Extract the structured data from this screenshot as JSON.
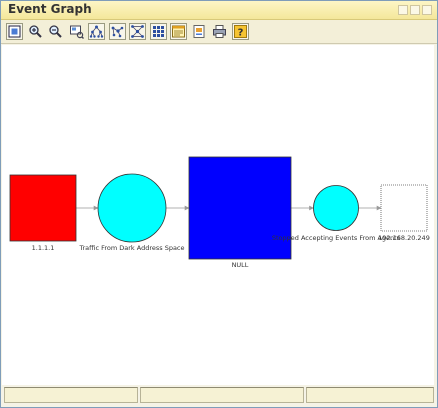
{
  "window": {
    "title": "Event Graph"
  },
  "toolbar": {
    "buttons": [
      {
        "name": "fit-to-window-icon"
      },
      {
        "name": "zoom-in-icon"
      },
      {
        "name": "zoom-out-icon"
      },
      {
        "name": "overview-icon"
      },
      {
        "name": "hierarchical-layout-icon"
      },
      {
        "name": "organic-layout-icon"
      },
      {
        "name": "circular-layout-icon"
      },
      {
        "name": "grid-layout-icon"
      },
      {
        "name": "properties-icon"
      },
      {
        "name": "export-icon"
      },
      {
        "name": "print-icon"
      },
      {
        "name": "help-icon"
      }
    ]
  },
  "graph": {
    "nodes": [
      {
        "id": "n1",
        "shape": "square",
        "color": "#ff0000",
        "label": "1.1.1.1"
      },
      {
        "id": "n2",
        "shape": "circle",
        "color": "#00ffff",
        "label": "Traffic From Dark Address Space"
      },
      {
        "id": "n3",
        "shape": "square",
        "color": "#0000ff",
        "label": "NULL"
      },
      {
        "id": "n4",
        "shape": "circle",
        "color": "#00ffff",
        "label": "Stopped Accepting Events From Agents"
      },
      {
        "id": "n5",
        "shape": "square",
        "color": "#ffffff",
        "label": "192.168.20.249"
      }
    ],
    "edges": [
      {
        "from": "n1",
        "to": "n2"
      },
      {
        "from": "n2",
        "to": "n3"
      },
      {
        "from": "n3",
        "to": "n4"
      },
      {
        "from": "n4",
        "to": "n5"
      }
    ],
    "edge_color": "#999999"
  },
  "statusbar": {
    "panes": [
      "",
      "",
      ""
    ]
  }
}
